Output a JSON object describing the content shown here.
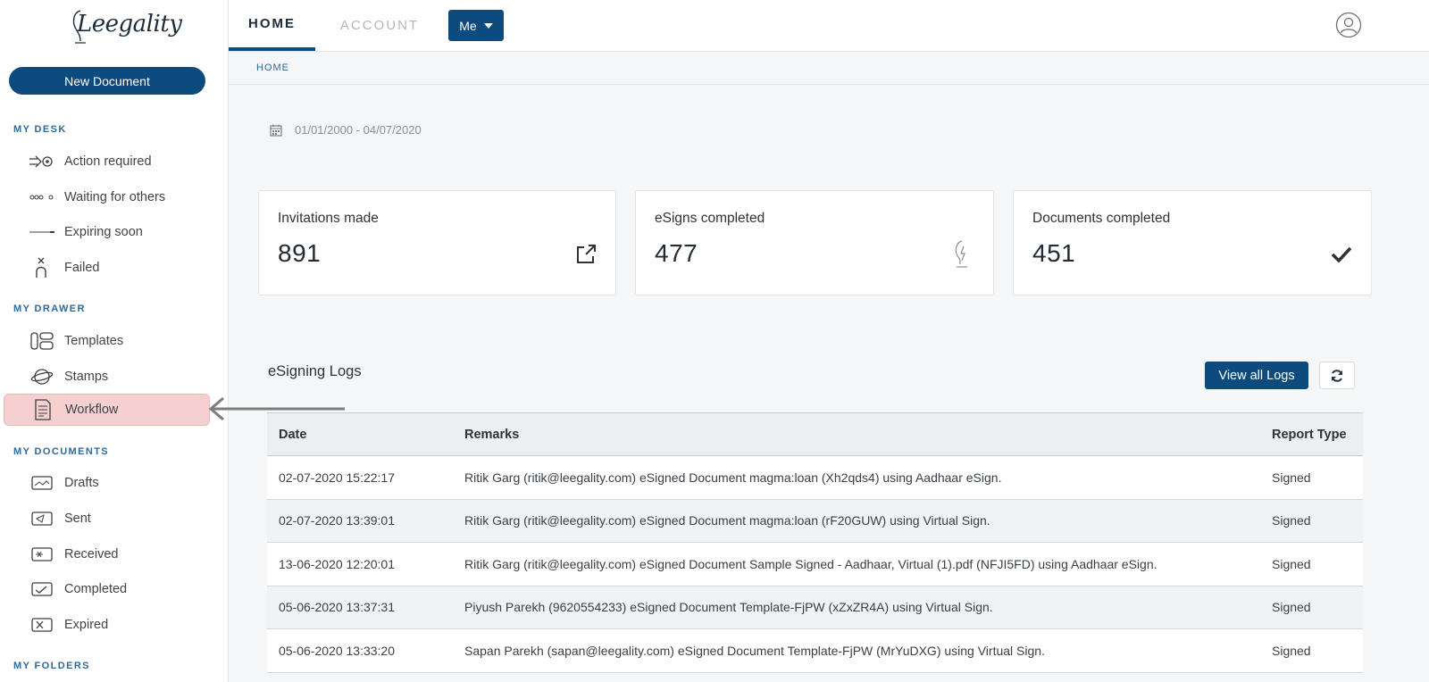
{
  "app": {
    "logo_text": "Leegality"
  },
  "sidebar": {
    "new_document": "New Document",
    "sections": {
      "desk": "MY DESK",
      "drawer": "MY DRAWER",
      "documents": "MY DOCUMENTS",
      "folders": "MY FOLDERS"
    },
    "desk_items": [
      {
        "label": "Action required",
        "icon": "action-required-icon"
      },
      {
        "label": "Waiting for others",
        "icon": "waiting-icon"
      },
      {
        "label": "Expiring soon",
        "icon": "expiring-icon"
      },
      {
        "label": "Failed",
        "icon": "failed-icon"
      }
    ],
    "drawer_items": [
      {
        "label": "Templates",
        "icon": "templates-icon"
      },
      {
        "label": "Stamps",
        "icon": "stamps-icon"
      },
      {
        "label": "Workflow",
        "icon": "workflow-icon"
      }
    ],
    "document_items": [
      {
        "label": "Drafts",
        "icon": "drafts-icon"
      },
      {
        "label": "Sent",
        "icon": "sent-icon"
      },
      {
        "label": "Received",
        "icon": "received-icon"
      },
      {
        "label": "Completed",
        "icon": "completed-icon"
      },
      {
        "label": "Expired",
        "icon": "expired-icon"
      }
    ]
  },
  "topbar": {
    "tabs": [
      {
        "label": "HOME"
      },
      {
        "label": "ACCOUNT"
      }
    ],
    "me_label": "Me"
  },
  "breadcrumb": "HOME",
  "date_range": "01/01/2000 - 04/07/2020",
  "stats": [
    {
      "label": "Invitations made",
      "value": "891",
      "icon": "external-link-icon"
    },
    {
      "label": "eSigns completed",
      "value": "477",
      "icon": "esign-icon"
    },
    {
      "label": "Documents completed",
      "value": "451",
      "icon": "checkmark-icon"
    }
  ],
  "logs": {
    "title": "eSigning Logs",
    "view_all": "View all Logs",
    "columns": [
      "Date",
      "Remarks",
      "Report Type"
    ],
    "rows": [
      [
        "02-07-2020 15:22:17",
        "Ritik Garg (ritik@leegality.com) eSigned Document magma:loan (Xh2qds4) using Aadhaar eSign.",
        "Signed"
      ],
      [
        "02-07-2020 13:39:01",
        "Ritik Garg (ritik@leegality.com) eSigned Document magma:loan (rF20GUW) using Virtual Sign.",
        "Signed"
      ],
      [
        "13-06-2020 12:20:01",
        "Ritik Garg (ritik@leegality.com) eSigned Document Sample Signed - Aadhaar, Virtual (1).pdf (NFJI5FD) using Aadhaar eSign.",
        "Signed"
      ],
      [
        "05-06-2020 13:37:31",
        "Piyush Parekh (9620554233) eSigned Document Template-FjPW (xZxZR4A) using Virtual Sign.",
        "Signed"
      ],
      [
        "05-06-2020 13:33:20",
        "Sapan Parekh (sapan@leegality.com) eSigned Document Template-FjPW (MrYuDXG) using Virtual Sign.",
        "Signed"
      ]
    ]
  },
  "colors": {
    "primary": "#0d4a7e",
    "highlight": "#f6d0d0",
    "section": "#2e6a99"
  }
}
